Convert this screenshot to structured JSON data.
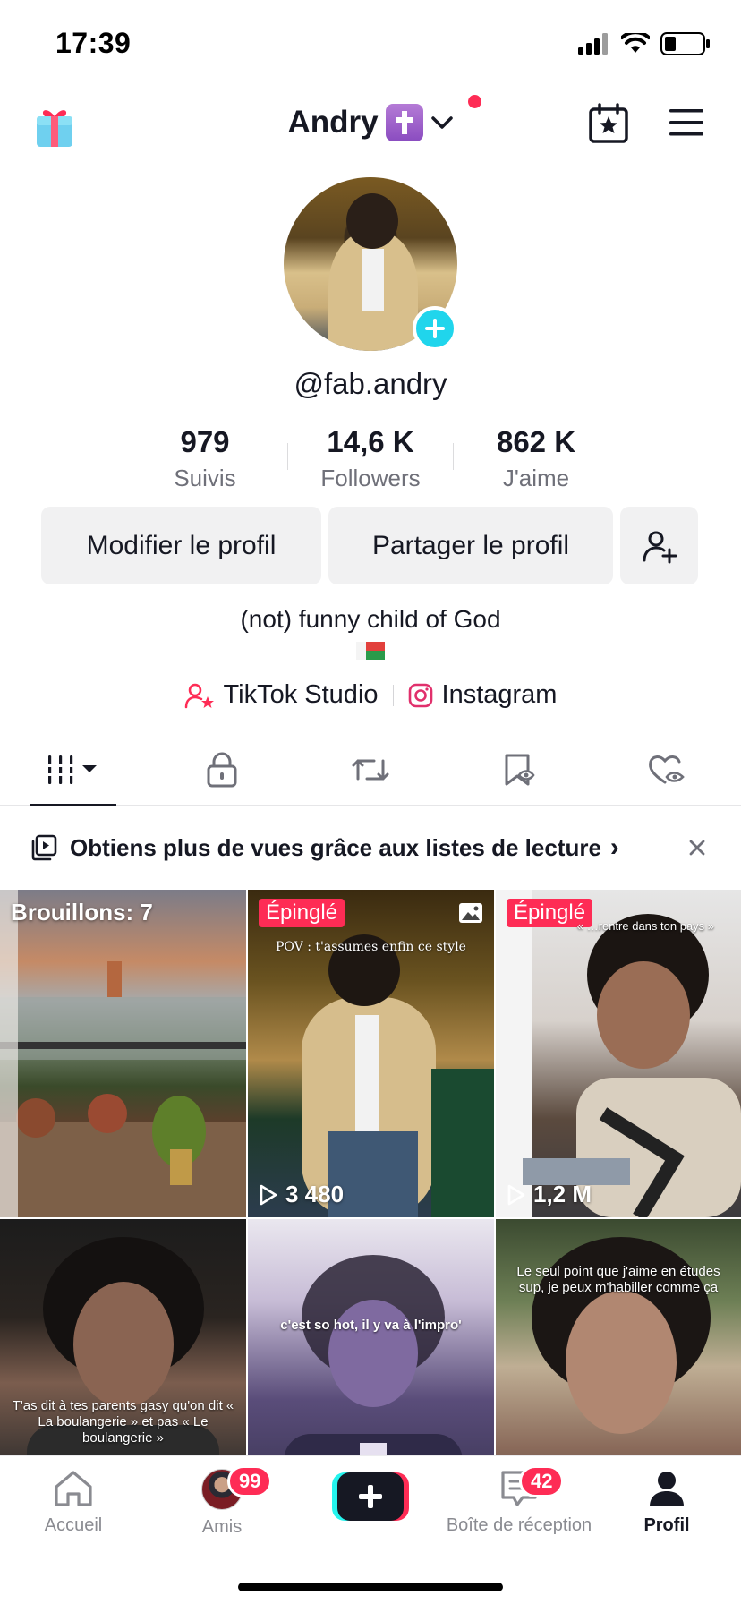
{
  "status_bar": {
    "time": "17:39"
  },
  "header": {
    "title": "Andry",
    "title_emoji": "✝️"
  },
  "profile": {
    "handle": "@fab.andry",
    "bio": "(not) funny child of God",
    "stats": [
      {
        "value": "979",
        "label": "Suivis"
      },
      {
        "value": "14,6 K",
        "label": "Followers"
      },
      {
        "value": "862 K",
        "label": "J'aime"
      }
    ],
    "buttons": {
      "edit": "Modifier le profil",
      "share": "Partager le profil"
    },
    "links": [
      {
        "label": "TikTok Studio",
        "icon": "tiktok-studio-icon"
      },
      {
        "label": "Instagram",
        "icon": "instagram-icon"
      }
    ]
  },
  "tabs": [
    {
      "icon": "grid-icon",
      "active": true
    },
    {
      "icon": "lock-icon",
      "active": false
    },
    {
      "icon": "repost-icon",
      "active": false
    },
    {
      "icon": "bookmark-icon",
      "active": false
    },
    {
      "icon": "liked-icon",
      "active": false
    }
  ],
  "playlist_banner": {
    "text": "Obtiens plus de vues grâce aux listes de lecture",
    "chevron": "›"
  },
  "grid": {
    "items": [
      {
        "label": "Brouillons: 7"
      },
      {
        "pinned": "Épinglé",
        "overlay": "POV : t'assumes enfin ce style",
        "views": "3 480"
      },
      {
        "pinned": "Épinglé",
        "overlay": "« …rentre dans ton pays »",
        "views": "1,2 M"
      },
      {
        "overlay": "T'as dit à tes parents gasy qu'on dit « La boulangerie » et pas « Le boulangerie »"
      },
      {
        "overlay": "c'est so hot, il y va à l'impro'"
      },
      {
        "overlay": "Le seul point que j'aime en études sup, je peux m'habiller comme ça"
      }
    ]
  },
  "bottom_nav": {
    "home": "Accueil",
    "friends": "Amis",
    "friends_badge": "99",
    "inbox": "Boîte de réception",
    "inbox_badge": "42",
    "profile": "Profil"
  },
  "colors": {
    "accent": "#fe2c55",
    "cyan": "#20d5ec",
    "text": "#161823",
    "muted": "#6f7079"
  }
}
